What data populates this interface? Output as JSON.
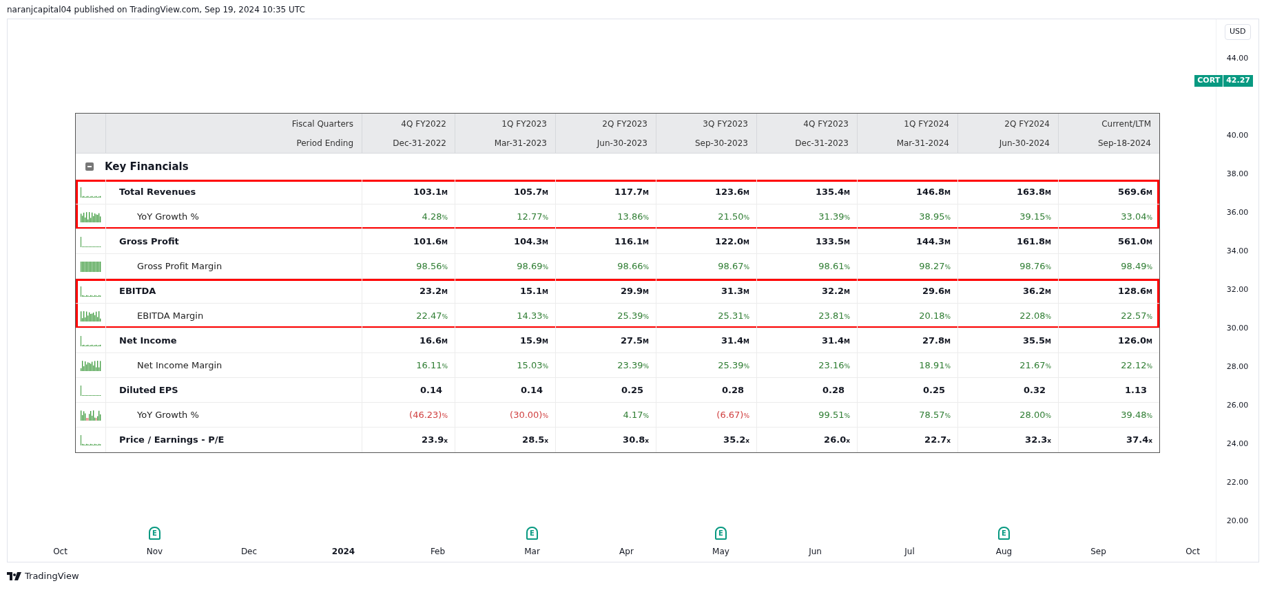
{
  "publisher_line": "naranjcapital04 published on TradingView.com, Sep 19, 2024 10:35 UTC",
  "table": {
    "header": {
      "top_label": "Fiscal Quarters",
      "bottom_label": "Period Ending"
    },
    "columns": [
      {
        "quarter": "4Q FY2022",
        "period": "Dec-31-2022"
      },
      {
        "quarter": "1Q FY2023",
        "period": "Mar-31-2023"
      },
      {
        "quarter": "2Q FY2023",
        "period": "Jun-30-2023"
      },
      {
        "quarter": "3Q FY2023",
        "period": "Sep-30-2023"
      },
      {
        "quarter": "4Q FY2023",
        "period": "Dec-31-2023"
      },
      {
        "quarter": "1Q FY2024",
        "period": "Mar-31-2024"
      },
      {
        "quarter": "2Q FY2024",
        "period": "Jun-30-2024"
      },
      {
        "quarter": "Current/LTM",
        "period": "Sep-18-2024"
      }
    ],
    "section_title": "Key Financials",
    "section_expanded": true,
    "groups": [
      {
        "highlighted": true,
        "rows": [
          {
            "label": "Total Revenues",
            "kind": "main",
            "cells": [
              {
                "value": "103.1",
                "unit": "M",
                "color": "#131722"
              },
              {
                "value": "105.7",
                "unit": "M",
                "color": "#131722"
              },
              {
                "value": "117.7",
                "unit": "M",
                "color": "#131722"
              },
              {
                "value": "123.6",
                "unit": "M",
                "color": "#131722"
              },
              {
                "value": "135.4",
                "unit": "M",
                "color": "#131722"
              },
              {
                "value": "146.8",
                "unit": "M",
                "color": "#131722"
              },
              {
                "value": "163.8",
                "unit": "M",
                "color": "#131722"
              },
              {
                "value": "569.6",
                "unit": "M",
                "color": "#131722"
              }
            ]
          },
          {
            "label": "YoY Growth %",
            "kind": "sub",
            "cells": [
              {
                "value": "4.28",
                "unit": "%",
                "color": "#2e7d32"
              },
              {
                "value": "12.77",
                "unit": "%",
                "color": "#2e7d32"
              },
              {
                "value": "13.86",
                "unit": "%",
                "color": "#2e7d32"
              },
              {
                "value": "21.50",
                "unit": "%",
                "color": "#2e7d32"
              },
              {
                "value": "31.39",
                "unit": "%",
                "color": "#2e7d32"
              },
              {
                "value": "38.95",
                "unit": "%",
                "color": "#2e7d32"
              },
              {
                "value": "39.15",
                "unit": "%",
                "color": "#2e7d32"
              },
              {
                "value": "33.04",
                "unit": "%",
                "color": "#2e7d32"
              }
            ]
          }
        ]
      },
      {
        "highlighted": false,
        "rows": [
          {
            "label": "Gross Profit",
            "kind": "main",
            "cells": [
              {
                "value": "101.6",
                "unit": "M",
                "color": "#131722"
              },
              {
                "value": "104.3",
                "unit": "M",
                "color": "#131722"
              },
              {
                "value": "116.1",
                "unit": "M",
                "color": "#131722"
              },
              {
                "value": "122.0",
                "unit": "M",
                "color": "#131722"
              },
              {
                "value": "133.5",
                "unit": "M",
                "color": "#131722"
              },
              {
                "value": "144.3",
                "unit": "M",
                "color": "#131722"
              },
              {
                "value": "161.8",
                "unit": "M",
                "color": "#131722"
              },
              {
                "value": "561.0",
                "unit": "M",
                "color": "#131722"
              }
            ]
          },
          {
            "label": "Gross Profit Margin",
            "kind": "sub",
            "cells": [
              {
                "value": "98.56",
                "unit": "%",
                "color": "#2e7d32"
              },
              {
                "value": "98.69",
                "unit": "%",
                "color": "#2e7d32"
              },
              {
                "value": "98.66",
                "unit": "%",
                "color": "#2e7d32"
              },
              {
                "value": "98.67",
                "unit": "%",
                "color": "#2e7d32"
              },
              {
                "value": "98.61",
                "unit": "%",
                "color": "#2e7d32"
              },
              {
                "value": "98.27",
                "unit": "%",
                "color": "#2e7d32"
              },
              {
                "value": "98.76",
                "unit": "%",
                "color": "#2e7d32"
              },
              {
                "value": "98.49",
                "unit": "%",
                "color": "#2e7d32"
              }
            ]
          }
        ]
      },
      {
        "highlighted": true,
        "rows": [
          {
            "label": "EBITDA",
            "kind": "main",
            "cells": [
              {
                "value": "23.2",
                "unit": "M",
                "color": "#131722"
              },
              {
                "value": "15.1",
                "unit": "M",
                "color": "#131722"
              },
              {
                "value": "29.9",
                "unit": "M",
                "color": "#131722"
              },
              {
                "value": "31.3",
                "unit": "M",
                "color": "#131722"
              },
              {
                "value": "32.2",
                "unit": "M",
                "color": "#131722"
              },
              {
                "value": "29.6",
                "unit": "M",
                "color": "#131722"
              },
              {
                "value": "36.2",
                "unit": "M",
                "color": "#131722"
              },
              {
                "value": "128.6",
                "unit": "M",
                "color": "#131722"
              }
            ]
          },
          {
            "label": "EBITDA Margin",
            "kind": "sub",
            "cells": [
              {
                "value": "22.47",
                "unit": "%",
                "color": "#2e7d32"
              },
              {
                "value": "14.33",
                "unit": "%",
                "color": "#2e7d32"
              },
              {
                "value": "25.39",
                "unit": "%",
                "color": "#2e7d32"
              },
              {
                "value": "25.31",
                "unit": "%",
                "color": "#2e7d32"
              },
              {
                "value": "23.81",
                "unit": "%",
                "color": "#2e7d32"
              },
              {
                "value": "20.18",
                "unit": "%",
                "color": "#2e7d32"
              },
              {
                "value": "22.08",
                "unit": "%",
                "color": "#2e7d32"
              },
              {
                "value": "22.57",
                "unit": "%",
                "color": "#2e7d32"
              }
            ]
          }
        ]
      },
      {
        "highlighted": false,
        "rows": [
          {
            "label": "Net Income",
            "kind": "main",
            "cells": [
              {
                "value": "16.6",
                "unit": "M",
                "color": "#131722"
              },
              {
                "value": "15.9",
                "unit": "M",
                "color": "#131722"
              },
              {
                "value": "27.5",
                "unit": "M",
                "color": "#131722"
              },
              {
                "value": "31.4",
                "unit": "M",
                "color": "#131722"
              },
              {
                "value": "31.4",
                "unit": "M",
                "color": "#131722"
              },
              {
                "value": "27.8",
                "unit": "M",
                "color": "#131722"
              },
              {
                "value": "35.5",
                "unit": "M",
                "color": "#131722"
              },
              {
                "value": "126.0",
                "unit": "M",
                "color": "#131722"
              }
            ]
          },
          {
            "label": "Net Income Margin",
            "kind": "sub",
            "cells": [
              {
                "value": "16.11",
                "unit": "%",
                "color": "#2e7d32"
              },
              {
                "value": "15.03",
                "unit": "%",
                "color": "#2e7d32"
              },
              {
                "value": "23.39",
                "unit": "%",
                "color": "#2e7d32"
              },
              {
                "value": "25.39",
                "unit": "%",
                "color": "#2e7d32"
              },
              {
                "value": "23.16",
                "unit": "%",
                "color": "#2e7d32"
              },
              {
                "value": "18.91",
                "unit": "%",
                "color": "#2e7d32"
              },
              {
                "value": "21.67",
                "unit": "%",
                "color": "#2e7d32"
              },
              {
                "value": "22.12",
                "unit": "%",
                "color": "#2e7d32"
              }
            ]
          },
          {
            "label": "Diluted EPS",
            "kind": "main",
            "cells": [
              {
                "value": "0.14",
                "color": "#131722"
              },
              {
                "value": "0.14",
                "color": "#131722"
              },
              {
                "value": "0.25",
                "color": "#131722"
              },
              {
                "value": "0.28",
                "color": "#131722"
              },
              {
                "value": "0.28",
                "color": "#131722"
              },
              {
                "value": "0.25",
                "color": "#131722"
              },
              {
                "value": "0.32",
                "color": "#131722"
              },
              {
                "value": "1.13",
                "color": "#131722"
              }
            ]
          },
          {
            "label": "YoY Growth %",
            "kind": "sub",
            "cells": [
              {
                "value": "(46.23)",
                "unit": "%",
                "color": "#d04040"
              },
              {
                "value": "(30.00)",
                "unit": "%",
                "color": "#d04040"
              },
              {
                "value": "4.17",
                "unit": "%",
                "color": "#2e7d32"
              },
              {
                "value": "(6.67)",
                "unit": "%",
                "color": "#d04040"
              },
              {
                "value": "99.51",
                "unit": "%",
                "color": "#2e7d32"
              },
              {
                "value": "78.57",
                "unit": "%",
                "color": "#2e7d32"
              },
              {
                "value": "28.00",
                "unit": "%",
                "color": "#2e7d32"
              },
              {
                "value": "39.48",
                "unit": "%",
                "color": "#2e7d32"
              }
            ]
          },
          {
            "label": "Price / Earnings - P/E",
            "kind": "main",
            "cells": [
              {
                "value": "23.9",
                "unit": "x",
                "color": "#131722"
              },
              {
                "value": "28.5",
                "unit": "x",
                "color": "#131722"
              },
              {
                "value": "30.8",
                "unit": "x",
                "color": "#131722"
              },
              {
                "value": "35.2",
                "unit": "x",
                "color": "#131722"
              },
              {
                "value": "26.0",
                "unit": "x",
                "color": "#131722"
              },
              {
                "value": "22.7",
                "unit": "x",
                "color": "#131722"
              },
              {
                "value": "32.3",
                "unit": "x",
                "color": "#131722"
              },
              {
                "value": "37.4",
                "unit": "x",
                "color": "#131722"
              }
            ]
          }
        ]
      }
    ]
  },
  "price_axis": {
    "currency": "USD",
    "symbol": "CORT",
    "last_price": "42.27",
    "labels": [
      "44.00",
      "40.00",
      "38.00",
      "36.00",
      "34.00",
      "32.00",
      "30.00",
      "28.00",
      "26.00",
      "24.00",
      "22.00",
      "20.00"
    ]
  },
  "time_axis": [
    {
      "label": "Oct",
      "kind": "month"
    },
    {
      "label": "Nov",
      "kind": "month",
      "earnings_marker": "E"
    },
    {
      "label": "Dec",
      "kind": "month"
    },
    {
      "label": "2024",
      "kind": "year"
    },
    {
      "label": "Feb",
      "kind": "month"
    },
    {
      "label": "Mar",
      "kind": "month",
      "earnings_marker": "E"
    },
    {
      "label": "Apr",
      "kind": "month"
    },
    {
      "label": "May",
      "kind": "month",
      "earnings_marker": "E"
    },
    {
      "label": "Jun",
      "kind": "month"
    },
    {
      "label": "Jul",
      "kind": "month"
    },
    {
      "label": "Aug",
      "kind": "month",
      "earnings_marker": "E"
    },
    {
      "label": "Sep",
      "kind": "month"
    },
    {
      "label": "Oct",
      "kind": "month"
    }
  ],
  "brand": "TradingView"
}
